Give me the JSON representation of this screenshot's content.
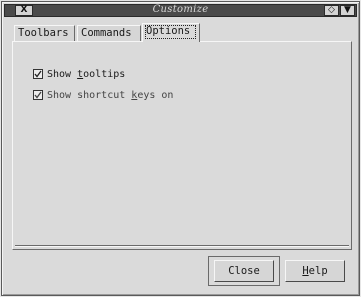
{
  "window": {
    "title": "Customize",
    "close_glyph": "X",
    "restore_glyph": "◇",
    "minimize_glyph": "▼"
  },
  "tabs": [
    {
      "label": "Toolbars",
      "selected": false
    },
    {
      "label": "Commands",
      "selected": false
    },
    {
      "label": "Options",
      "selected": true
    }
  ],
  "options": {
    "show_tooltips": {
      "prefix": "Show ",
      "underlined": "t",
      "suffix": "ooltips",
      "checked": true
    },
    "show_shortcut_keys": {
      "prefix": "Show shortcut ",
      "underlined": "k",
      "suffix": "eys on",
      "checked": true
    }
  },
  "buttons": {
    "close_label": "Close",
    "help_underlined": "H",
    "help_rest": "elp"
  }
}
